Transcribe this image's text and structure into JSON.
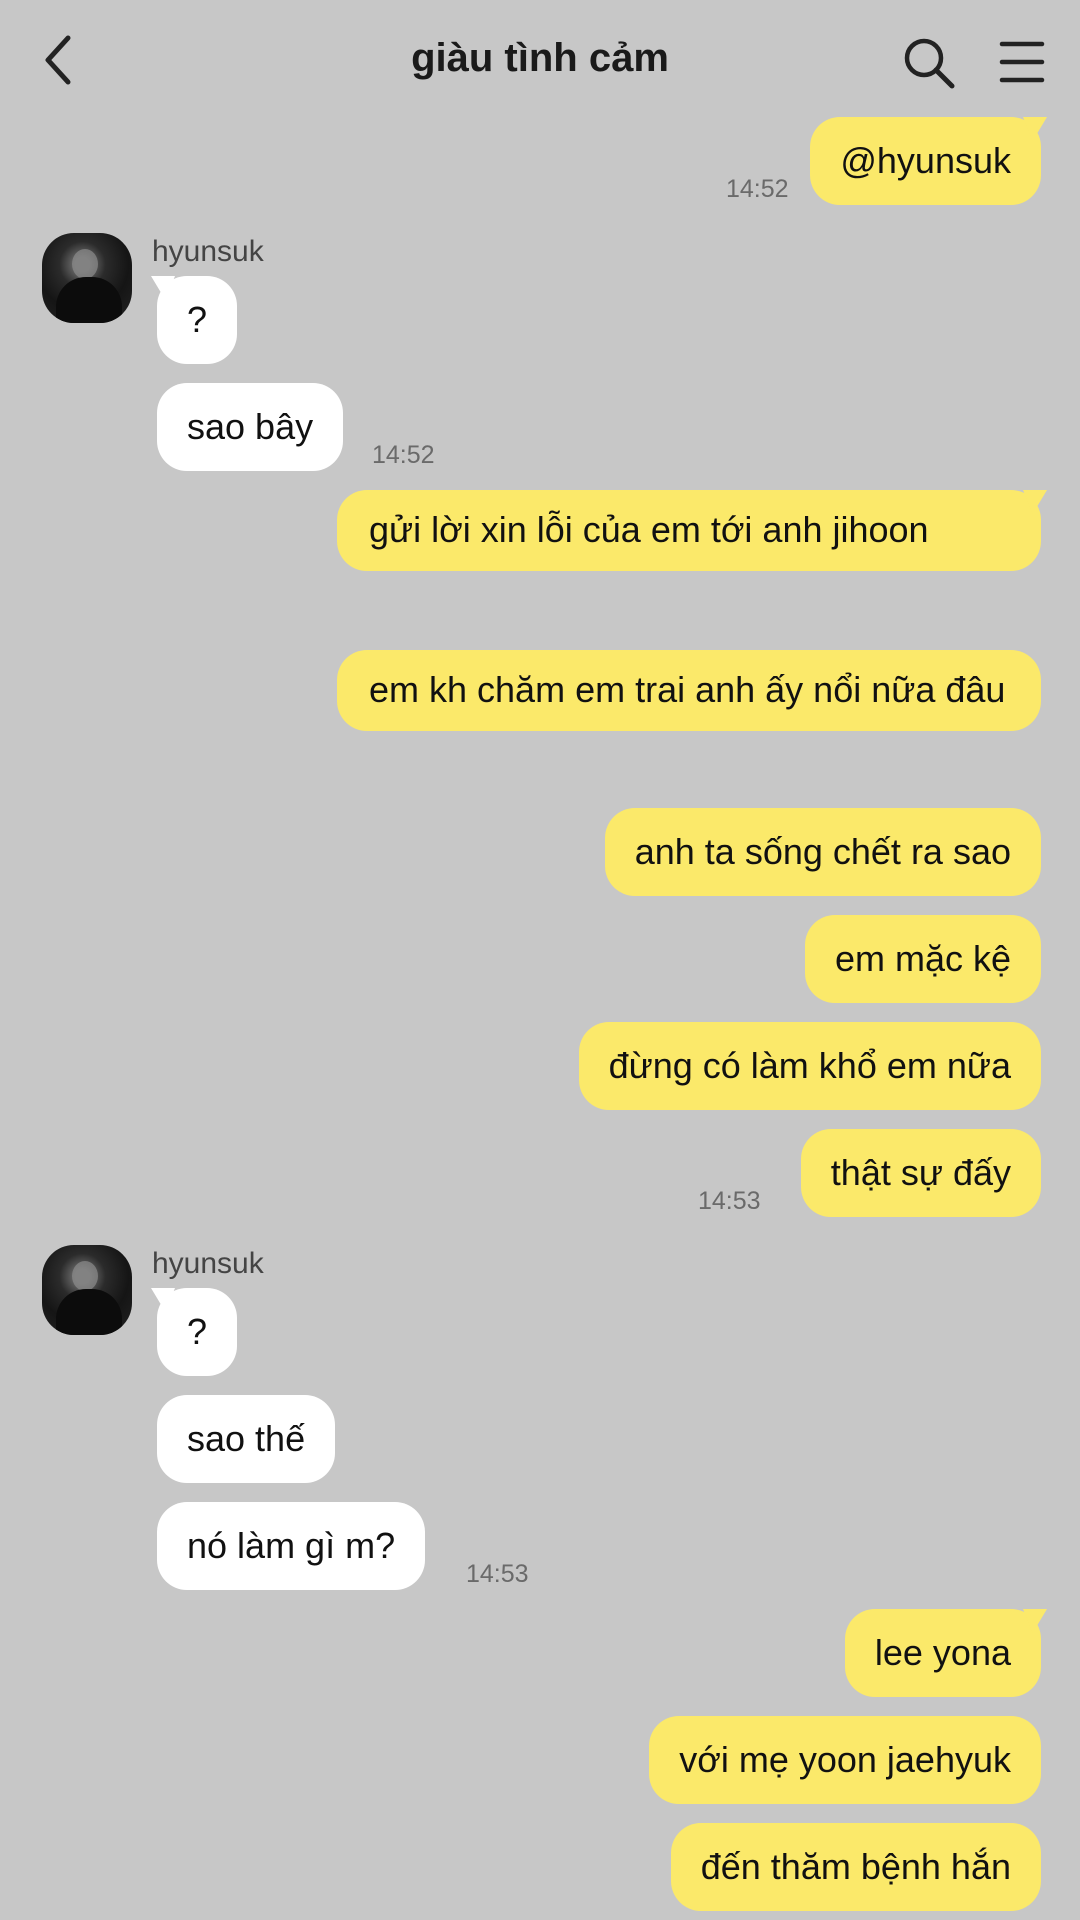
{
  "header": {
    "title": "giàu tình cảm"
  },
  "messages": {
    "m1": "@hyunsuk",
    "t1": "14:52",
    "sender1": "hyunsuk",
    "m2": "?",
    "m3": "sao bây",
    "t2": "14:52",
    "m4": "gửi lời xin lỗi của em tới anh jihoon",
    "m5": "em kh chăm em trai anh ấy nổi nữa đâu",
    "m6": "anh ta sống chết ra sao",
    "m7": "em mặc kệ",
    "m8": "đừng có làm khổ em nữa",
    "m9": "thật sự đấy",
    "t3": "14:53",
    "sender2": "hyunsuk",
    "m10": "?",
    "m11": "sao thế",
    "m12": "nó làm gì m?",
    "t4": "14:53",
    "m13": "lee yona",
    "m14": "với mẹ yoon jaehyuk",
    "m15": "đến thăm bệnh hắn"
  },
  "icons": {
    "back": "back-arrow-icon",
    "search": "search-icon",
    "menu": "menu-icon"
  },
  "colors": {
    "background": "#c7c7c7",
    "outgoing_bubble": "#fbe96a",
    "incoming_bubble": "#ffffff"
  }
}
